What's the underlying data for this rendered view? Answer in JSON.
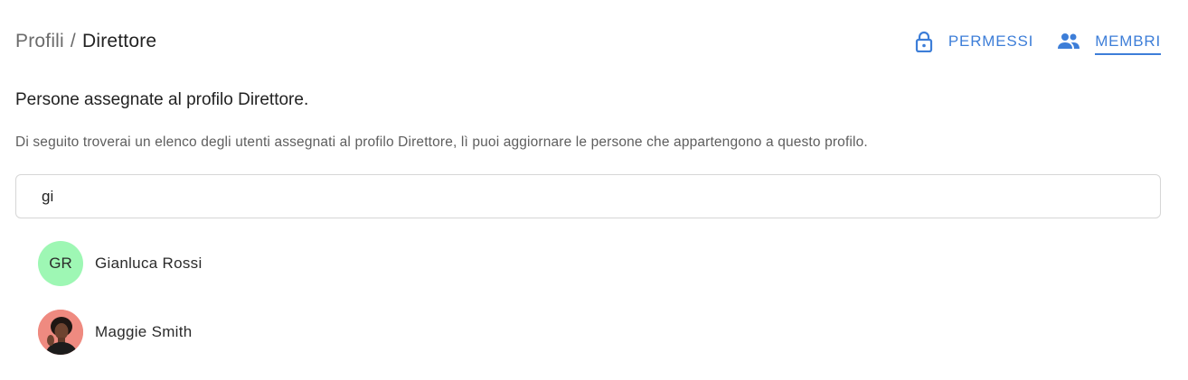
{
  "breadcrumb": {
    "root": "Profili",
    "separator": "/",
    "current": "Direttore"
  },
  "tabs": [
    {
      "label": "PERMESSI",
      "icon": "lock-icon",
      "active": false
    },
    {
      "label": "MEMBRI",
      "icon": "people-icon",
      "active": true
    }
  ],
  "subtitle": "Persone assegnate al profilo Direttore.",
  "description": "Di seguito troverai un elenco degli utenti assegnati al profilo Direttore, lì puoi aggiornare le persone che appartengono a questo profilo.",
  "search": {
    "value": "gi",
    "placeholder": ""
  },
  "members": [
    {
      "initials": "GR",
      "name": "Gianluca Rossi",
      "avatar_color": "#9ef7b4",
      "avatar_type": "initials"
    },
    {
      "initials": "",
      "name": "Maggie Smith",
      "avatar_color": "#ef8a80",
      "avatar_type": "photo"
    }
  ],
  "colors": {
    "accent": "#3d7ed8",
    "border": "#d6d6d6",
    "muted_text": "#5e5e5e"
  }
}
